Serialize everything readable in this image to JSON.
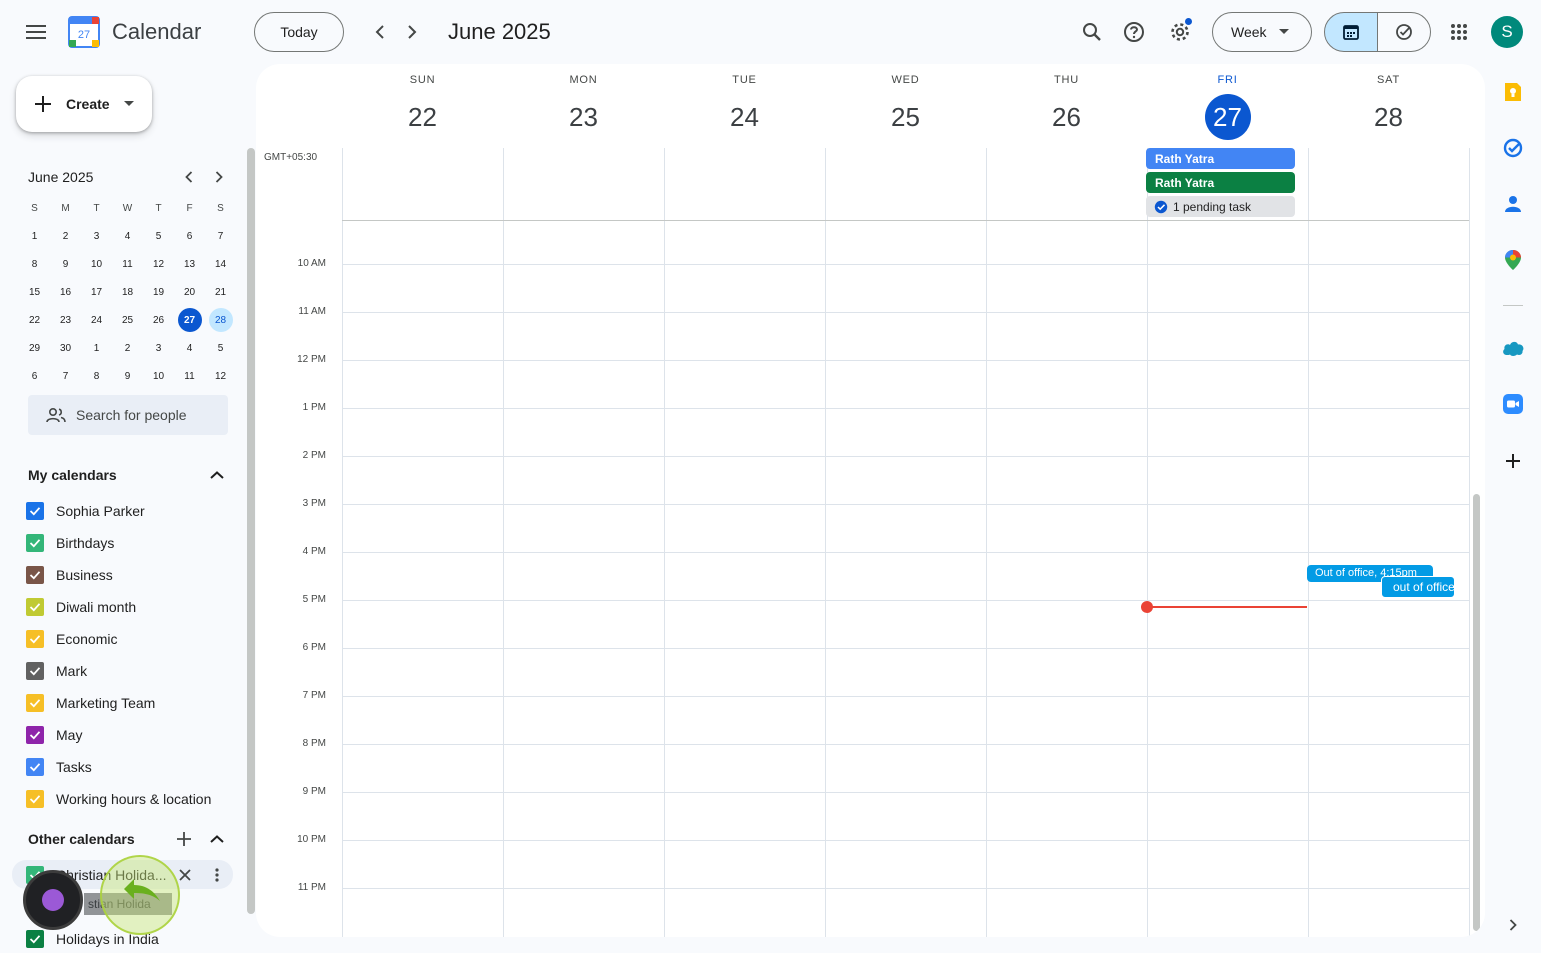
{
  "header": {
    "app_title": "Calendar",
    "logo_day": "27",
    "today_label": "Today",
    "month_title": "June 2025",
    "view_label": "Week",
    "avatar_initial": "S"
  },
  "sidebar": {
    "create_label": "Create",
    "mini_calendar": {
      "title": "June 2025",
      "weekdays": [
        "S",
        "M",
        "T",
        "W",
        "T",
        "F",
        "S"
      ],
      "weeks": [
        [
          "1",
          "2",
          "3",
          "4",
          "5",
          "6",
          "7"
        ],
        [
          "8",
          "9",
          "10",
          "11",
          "12",
          "13",
          "14"
        ],
        [
          "15",
          "16",
          "17",
          "18",
          "19",
          "20",
          "21"
        ],
        [
          "22",
          "23",
          "24",
          "25",
          "26",
          "27",
          "28"
        ],
        [
          "29",
          "30",
          "1",
          "2",
          "3",
          "4",
          "5"
        ],
        [
          "6",
          "7",
          "8",
          "9",
          "10",
          "11",
          "12"
        ]
      ],
      "today": "27",
      "selected": "28"
    },
    "search_people_placeholder": "Search for people",
    "my_calendars_title": "My calendars",
    "my_calendars": [
      {
        "label": "Sophia Parker",
        "color": "#1a73e8"
      },
      {
        "label": "Birthdays",
        "color": "#33b679"
      },
      {
        "label": "Business",
        "color": "#795548"
      },
      {
        "label": "Diwali month",
        "color": "#c0ca33"
      },
      {
        "label": "Economic",
        "color": "#f6bf26"
      },
      {
        "label": "Mark",
        "color": "#616161"
      },
      {
        "label": "Marketing Team",
        "color": "#f6bf26"
      },
      {
        "label": "May",
        "color": "#8e24aa"
      },
      {
        "label": "Tasks",
        "color": "#4285f4"
      },
      {
        "label": "Working hours & location",
        "color": "#f6bf26"
      }
    ],
    "other_calendars_title": "Other calendars",
    "other_calendars": [
      {
        "label": "Christian Holida...",
        "color": "#33b679"
      },
      {
        "label": "Holidays in India",
        "color": "#0b8043"
      }
    ],
    "drag_ghost_text": "stian Holida"
  },
  "week": {
    "timezone": "GMT+05:30",
    "days": [
      {
        "dow": "SUN",
        "num": "22"
      },
      {
        "dow": "MON",
        "num": "23"
      },
      {
        "dow": "TUE",
        "num": "24"
      },
      {
        "dow": "WED",
        "num": "25"
      },
      {
        "dow": "THU",
        "num": "26"
      },
      {
        "dow": "FRI",
        "num": "27",
        "today": true
      },
      {
        "dow": "SAT",
        "num": "28"
      }
    ],
    "hours": [
      "10 AM",
      "11 AM",
      "12 PM",
      "1 PM",
      "2 PM",
      "3 PM",
      "4 PM",
      "5 PM",
      "6 PM",
      "7 PM",
      "8 PM",
      "9 PM",
      "10 PM",
      "11 PM"
    ],
    "all_day_events": [
      {
        "title": "Rath Yatra",
        "color": "#4285f4"
      },
      {
        "title": "Rath Yatra",
        "color": "#0b8043"
      }
    ],
    "pending_task": "1 pending task",
    "timed_events": [
      {
        "title": "Out of office, 4:15pm",
        "color": "#039be5"
      },
      {
        "title": "out of office",
        "color": "#039be5"
      }
    ]
  }
}
